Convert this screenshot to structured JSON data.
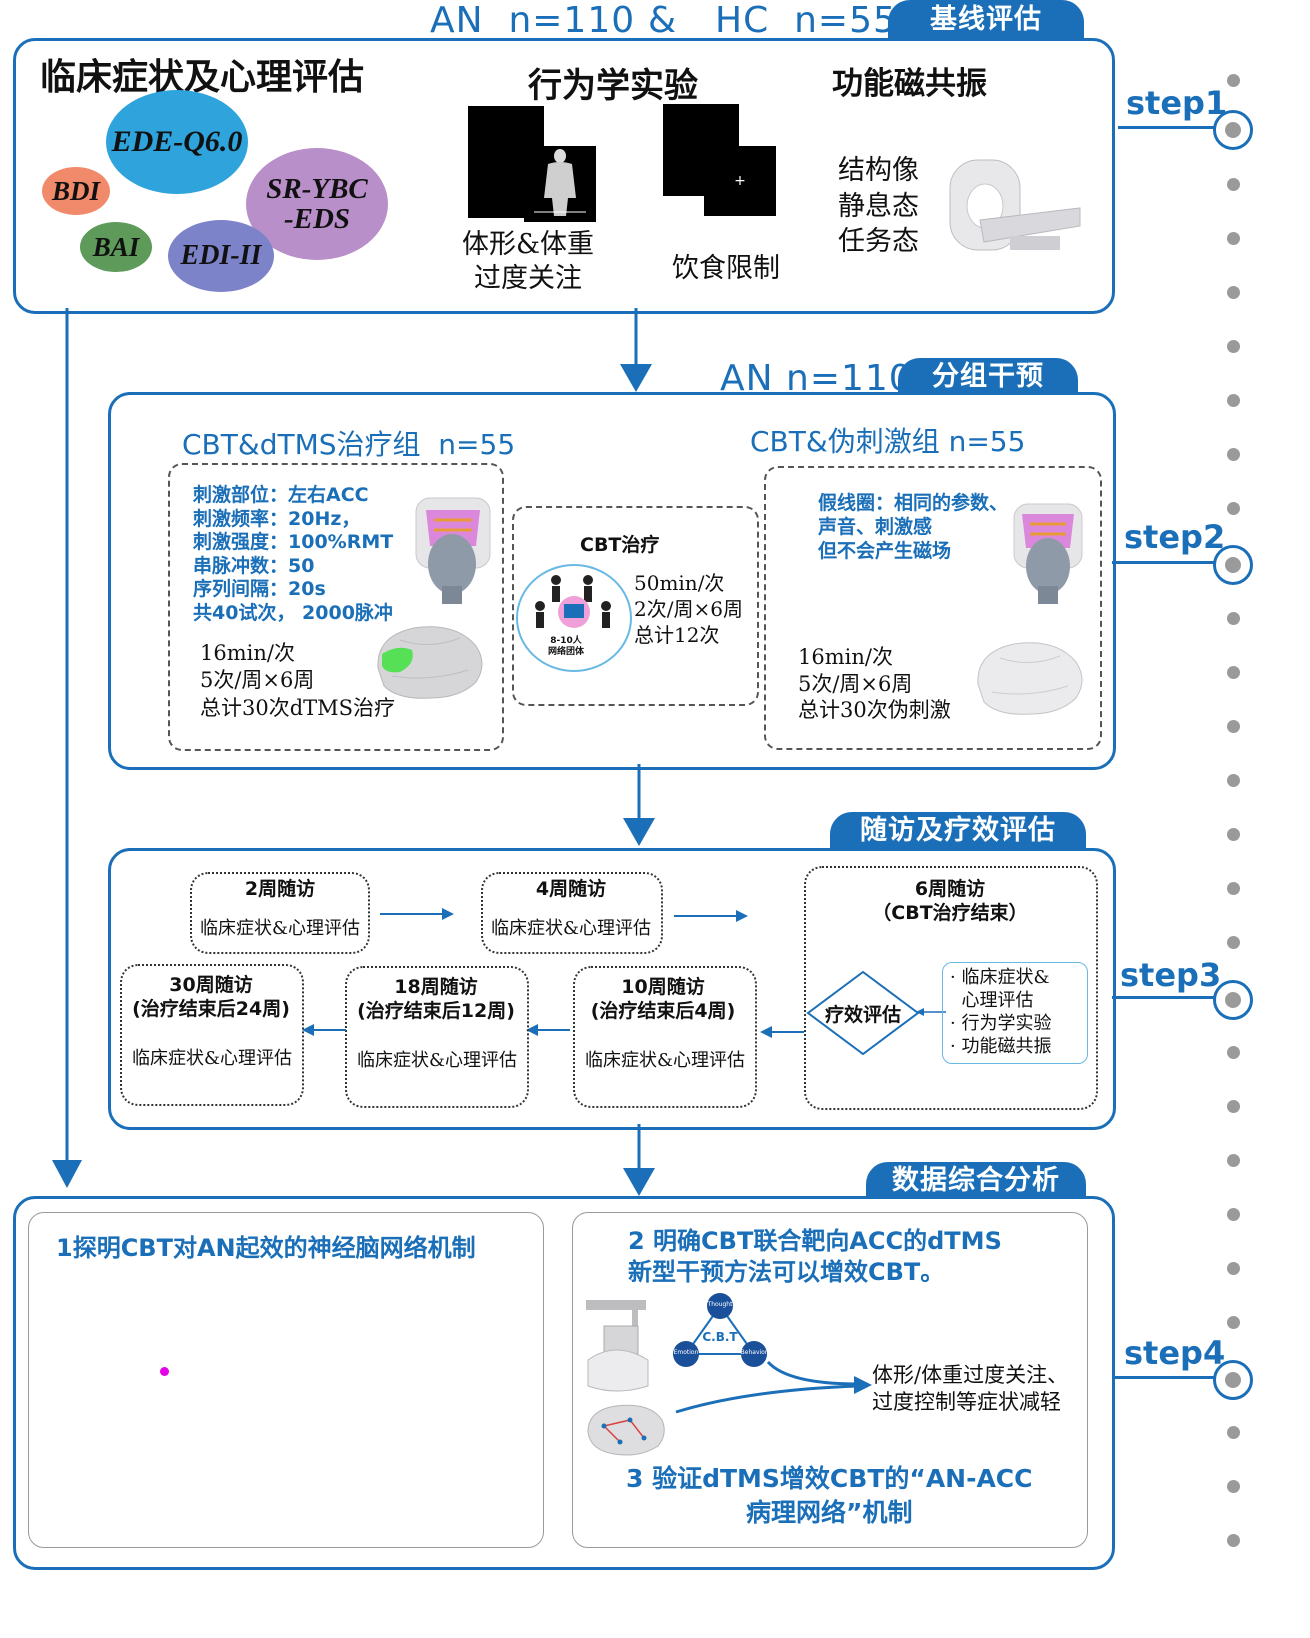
{
  "colors": {
    "primary": "#1a6fb8",
    "bdi": "#f08a6a",
    "ede": "#2ea3dc",
    "sr": "#b88fc8",
    "bai": "#5e9a5a",
    "edi": "#7d83c9",
    "highlight": "#e600e6"
  },
  "top_header": {
    "an": "AN  n=110",
    "amp": "&",
    "hc": "HC  n=55",
    "tab": "基线评估"
  },
  "step1": {
    "clinical_title": "临床症状及心理评估",
    "scales": [
      "EDE-Q6.0",
      "BDI",
      "SR-YBC-EDS",
      "BAI",
      "EDI-II"
    ],
    "behavior_title": "行为学实验",
    "task1": "体形&体重\n过度关注",
    "task2": "饮食限制",
    "fmri_title": "功能磁共振",
    "fmri_items": "结构像\n静息态\n任务态"
  },
  "step2": {
    "header_n": "AN n=110",
    "tab": "分组干预",
    "group1_title": "CBT&dTMS治疗组  n=55",
    "group1_params": "刺激部位：左右ACC\n刺激频率：20Hz，\n刺激强度：100%RMT\n串脉冲数：50\n序列间隔：20s\n共40试次， 2000脉冲",
    "group1_schedule": "16min/次\n5次/周×6周\n总计30次dTMS治疗",
    "cbt_title": "CBT治疗",
    "cbt_group_label": "8-10人\n网络团体",
    "cbt_schedule": "50min/次\n2次/周×6周\n总计12次",
    "group2_title": "CBT&伪刺激组 n=55",
    "group2_desc": "假线圈：相同的参数、\n声音、刺激感\n但不会产生磁场",
    "group2_schedule": "16min/次\n5次/周×6周\n总计30次伪刺激"
  },
  "step3": {
    "tab": "随访及疗效评估",
    "fu2_title": "2周随访",
    "fu4_title": "4周随访",
    "fu6_title": "6周随访\n（CBT治疗结束）",
    "fu10_title": "10周随访\n(治疗结束后4周)",
    "fu18_title": "18周随访\n(治疗结束后12周)",
    "fu30_title": "30周随访\n(治疗结束后24周)",
    "clinical": "临床症状&心理评估",
    "efficacy": "疗效评估",
    "efficacy_items": "· 临床症状&\n  心理评估\n· 行为学实验\n· 功能磁共振"
  },
  "step4": {
    "tab": "数据综合分析",
    "goal1": "1探明CBT对AN起效的神经脑网络机制",
    "goal2": "2 明确CBT联合靶向ACC的dTMS\n新型干预方法可以增效CBT。",
    "cbt_triangle": {
      "center": "C.B.T",
      "top": "Thought",
      "left": "Emotion",
      "right": "Behavior"
    },
    "outcome": "体形/体重过度关注、\n过度控制等症状减轻",
    "goal3": "3 验证dTMS增效CBT的“AN-ACC\n病理网络”机制"
  },
  "steps": [
    "step1",
    "step2",
    "step3",
    "step4"
  ]
}
